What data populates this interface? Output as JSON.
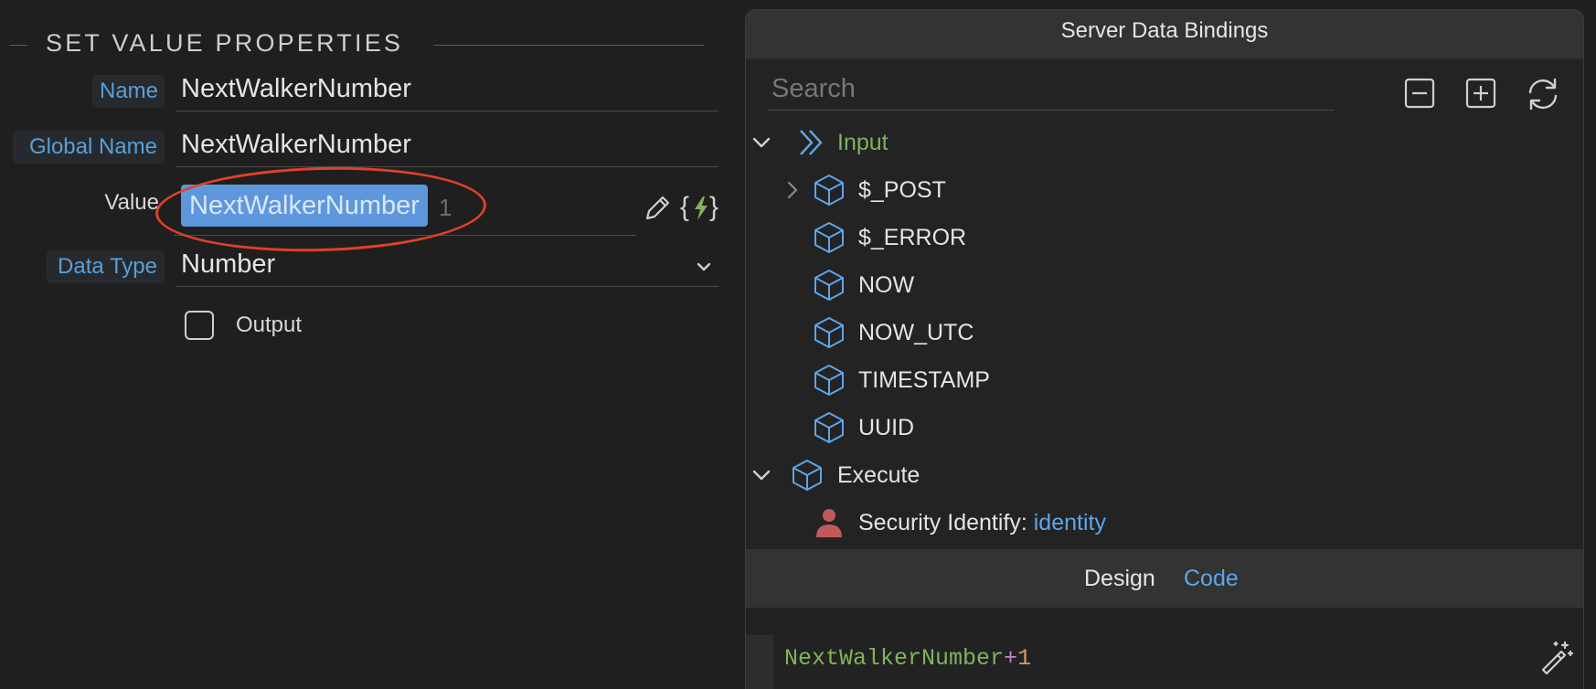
{
  "properties": {
    "section_title": "SET VALUE PROPERTIES",
    "name_label": "Name",
    "name_value": "NextWalkerNumber",
    "global_name_label": "Global Name",
    "global_name_value": "NextWalkerNumber",
    "value_label": "Value",
    "value_token": "NextWalkerNumber",
    "value_suffix": "1",
    "data_type_label": "Data Type",
    "data_type_value": "Number",
    "output_label": "Output",
    "output_checked": false,
    "icons": {
      "edit": "pencil-icon",
      "bind": "dynamic-data-icon",
      "dropdown": "chevron-down-icon"
    }
  },
  "bindings": {
    "title": "Server Data Bindings",
    "search_placeholder": "Search",
    "toolbar": {
      "collapse": "collapse-all-icon",
      "expand": "expand-all-icon",
      "refresh": "refresh-icon"
    },
    "tree": [
      {
        "label": "Input",
        "expanded": true,
        "icon": "double-chevron-icon",
        "color": "#7fb35c"
      },
      {
        "label": "$_POST",
        "collapsible": true,
        "icon": "cube-icon"
      },
      {
        "label": "$_ERROR",
        "icon": "cube-icon"
      },
      {
        "label": "NOW",
        "icon": "cube-icon"
      },
      {
        "label": "NOW_UTC",
        "icon": "cube-icon"
      },
      {
        "label": "TIMESTAMP",
        "icon": "cube-icon"
      },
      {
        "label": "UUID",
        "icon": "cube-icon"
      },
      {
        "label": "Execute",
        "expanded": true,
        "icon": "cube-icon"
      },
      {
        "label": "Security Identify: ",
        "value": "identity",
        "icon": "user-icon"
      }
    ],
    "tabs": {
      "design": "Design",
      "code": "Code",
      "active": "Code"
    },
    "code": {
      "identifier": "NextWalkerNumber",
      "operator": "+",
      "number": "1"
    }
  },
  "colors": {
    "accent_blue": "#5da6e8",
    "green": "#7fb35c",
    "highlight_ellipse": "#e0402a",
    "token_bg": "#5f97dc"
  }
}
